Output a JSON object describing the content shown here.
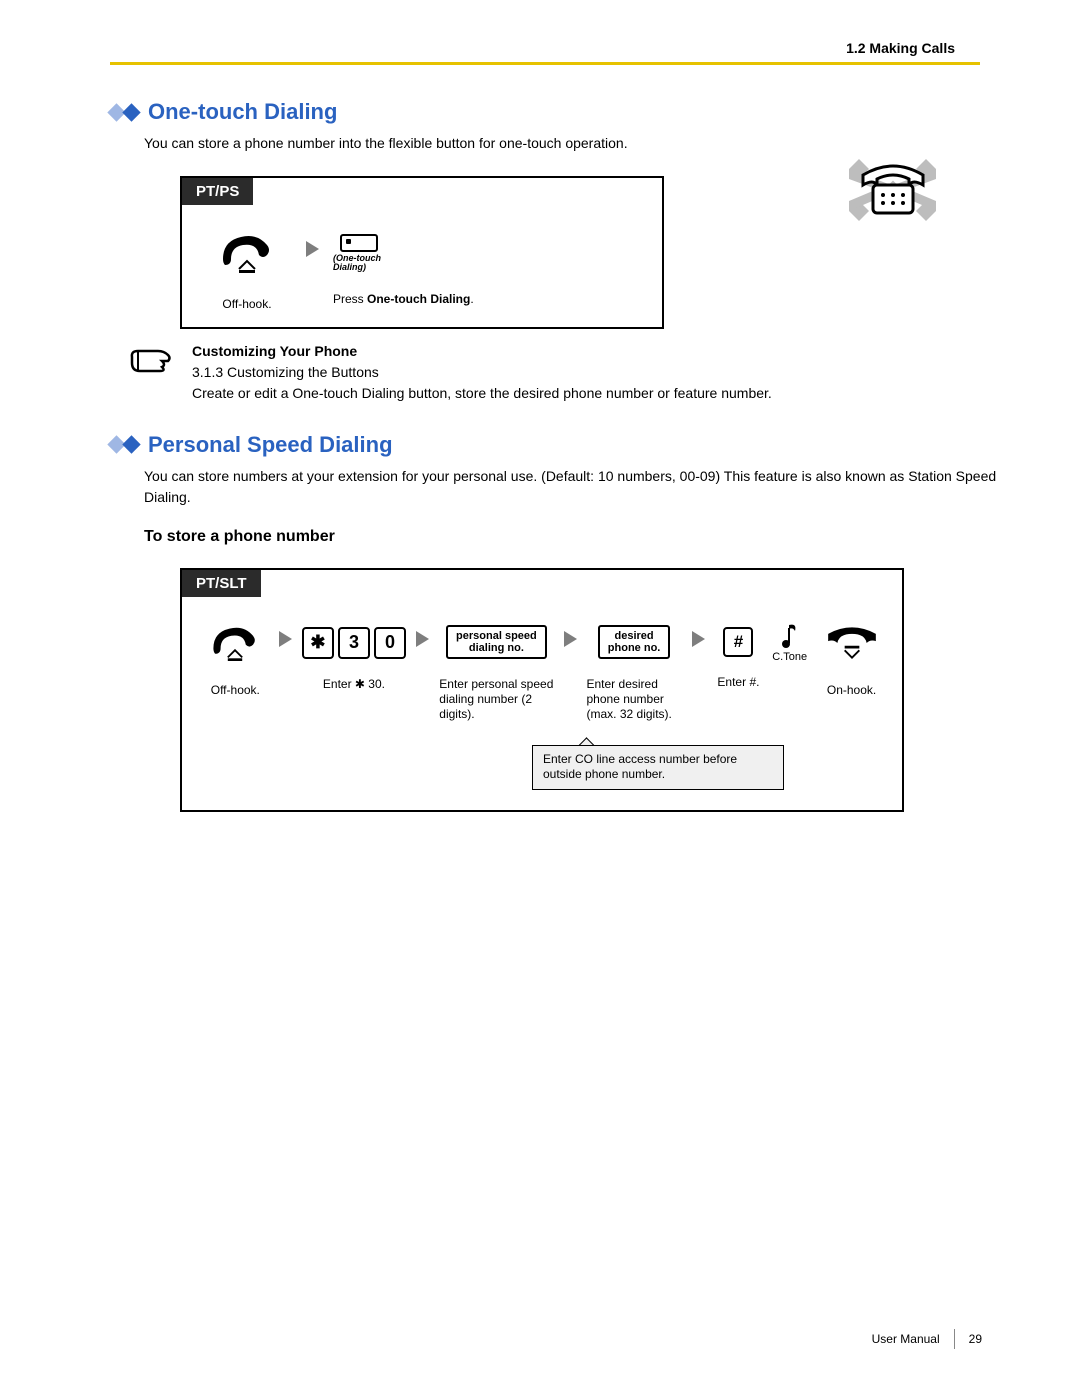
{
  "header": {
    "section_ref": "1.2 Making Calls"
  },
  "one_touch": {
    "title": "One-touch Dialing",
    "intro": "You can store a phone number into the flexible button for one-touch operation.",
    "tab": "PT/PS",
    "step1_caption": "Off-hook.",
    "step2_prefix": "Press ",
    "step2_bold": "One-touch Dialing",
    "step2_suffix": ".",
    "button_label_l1": "(One-touch",
    "button_label_l2": "Dialing)",
    "note_title": "Customizing Your Phone",
    "note_line1": "3.1.3 Customizing the Buttons",
    "note_line2": "Create or edit a One-touch Dialing button, store the desired phone number or feature number."
  },
  "psd": {
    "title": "Personal Speed Dialing",
    "intro": "You can store numbers at your extension for your personal use. (Default: 10 numbers, 00-09) This feature is also known as Station Speed Dialing.",
    "sub": "To store a phone number",
    "tab": "PT/SLT",
    "keys": {
      "star": "✱",
      "k3": "3",
      "k0": "0",
      "hash": "#"
    },
    "fields": {
      "psd_no_l1": "personal speed",
      "psd_no_l2": "dialing no.",
      "desired_l1": "desired",
      "desired_l2": "phone no."
    },
    "captions": {
      "offhook": "Off-hook.",
      "enter30_pre": "Enter ",
      "enter30_bold": "✱ 30",
      "enter30_suf": ".",
      "enterpsd_pre": "Enter ",
      "enterpsd_bold": "personal speed dialing number",
      "enterpsd_suf": " (2 digits).",
      "enterdesired_pre": "Enter ",
      "enterdesired_bold": "desired phone number",
      "enterdesired_suf": " (max. 32 digits).",
      "enterhash_pre": "Enter ",
      "enterhash_bold": "#",
      "enterhash_suf": ".",
      "onhook": "On-hook.",
      "ctone": "C.Tone"
    },
    "callout": "Enter CO line access number before outside phone number."
  },
  "footer": {
    "manual": "User Manual",
    "page": "29"
  }
}
